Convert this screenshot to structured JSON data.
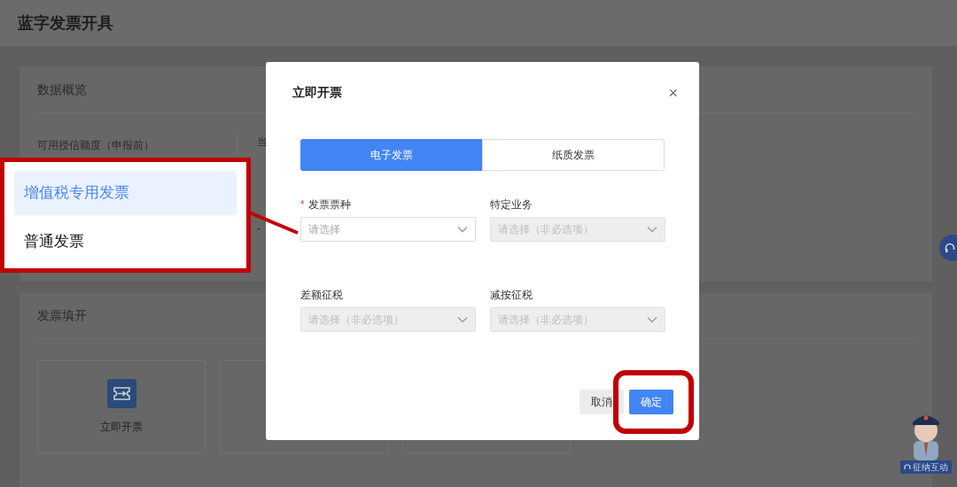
{
  "page": {
    "title": "蓝字发票开具"
  },
  "overview": {
    "title": "数据概览",
    "credit_label": "可用授信额度（申报前）",
    "column_2_label": "当",
    "column_2_row_2": "-"
  },
  "invoice_fill": {
    "title": "发票填开",
    "card_label": "立即开票"
  },
  "dialog": {
    "title": "立即开票",
    "close": "×",
    "tabs": [
      {
        "label": "电子发票",
        "selected": true
      },
      {
        "label": "纸质发票",
        "selected": false
      }
    ],
    "fields": [
      {
        "label": "发票票种",
        "required_mark": "*",
        "placeholder": "请选择",
        "disabled": false
      },
      {
        "label": "特定业务",
        "placeholder": "请选择（非必选项）",
        "disabled": true
      },
      {
        "label": "差额征税",
        "placeholder": "请选择（非必选项）",
        "disabled": true
      },
      {
        "label": "减按征税",
        "placeholder": "请选择（非必选项）",
        "disabled": true
      }
    ],
    "buttons": [
      {
        "label": "取消",
        "kind": "secondary",
        "highlighted": false
      },
      {
        "label": "确定",
        "kind": "primary",
        "highlighted": true
      }
    ]
  },
  "callout": {
    "options": [
      {
        "label": "增值税专用发票",
        "selected": true
      },
      {
        "label": "普通发票",
        "selected": false
      }
    ]
  },
  "assistant": {
    "badge": "征纳互动"
  }
}
